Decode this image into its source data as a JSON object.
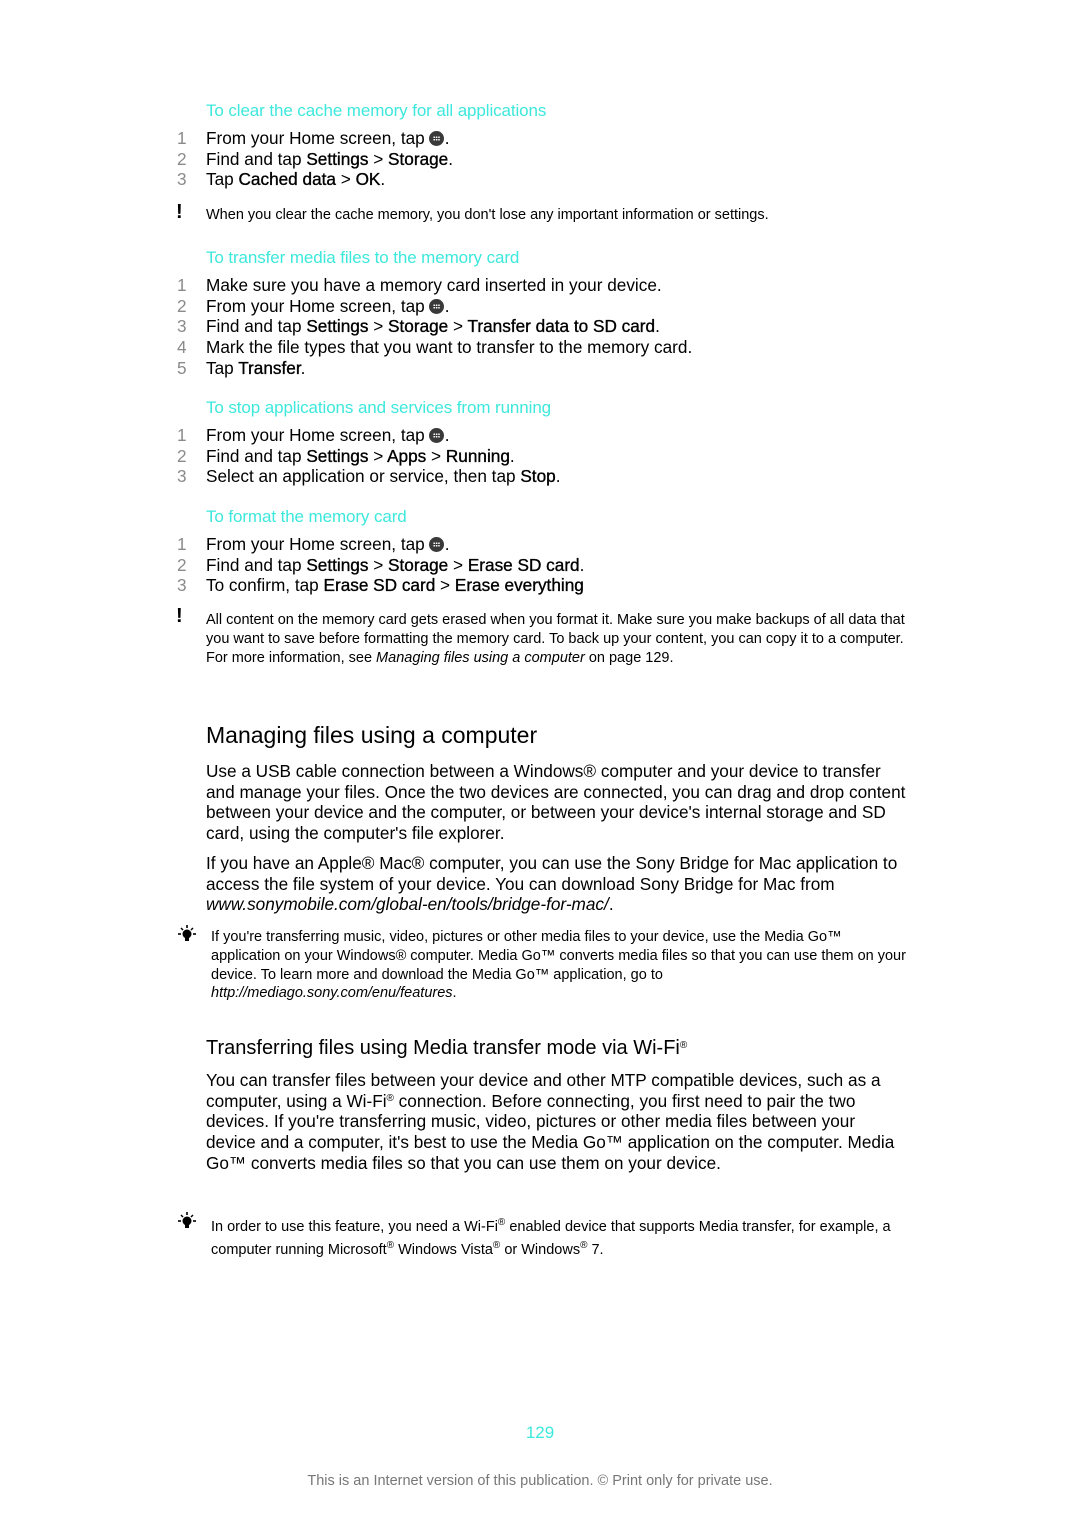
{
  "sections": [
    {
      "heading": "To clear the cache memory for all applications",
      "steps": [
        {
          "num": "1",
          "pre": "From your Home screen, tap",
          "icon": "apps-icon",
          "post": "."
        },
        {
          "num": "2",
          "pre": "Find and tap ",
          "b1": "Settings",
          "sep1": " > ",
          "b2": "Storage",
          "post": "."
        },
        {
          "num": "3",
          "pre": "Tap ",
          "b1": "Cached data",
          "sep1": " > ",
          "b2": "OK",
          "post": "."
        }
      ],
      "note": {
        "icon": "warning-icon",
        "text": "When you clear the cache memory, you don't lose any important information or settings."
      }
    },
    {
      "heading": "To transfer media files to the memory card",
      "steps": [
        {
          "num": "1",
          "text": "Make sure you have a memory card inserted in your device."
        },
        {
          "num": "2",
          "pre": "From your Home screen, tap",
          "icon": "apps-icon",
          "post": "."
        },
        {
          "num": "3",
          "pre": "Find and tap ",
          "b1": "Settings",
          "sep1": " > ",
          "b2": "Storage",
          "sep2": " > ",
          "b3": "Transfer data to SD card",
          "post": "."
        },
        {
          "num": "4",
          "text": "Mark the file types that you want to transfer to the memory card."
        },
        {
          "num": "5",
          "pre": "Tap ",
          "b1": "Transfer",
          "post": "."
        }
      ]
    },
    {
      "heading": "To stop applications and services from running",
      "steps": [
        {
          "num": "1",
          "pre": "From your Home screen, tap",
          "icon": "apps-icon",
          "post": "."
        },
        {
          "num": "2",
          "pre": "Find and tap ",
          "b1": "Settings",
          "sep1": " > ",
          "b2": "Apps",
          "sep2": " > ",
          "b3": "Running",
          "post": "."
        },
        {
          "num": "3",
          "pre": "Select an application or service, then tap ",
          "b1": "Stop",
          "post": "."
        }
      ]
    },
    {
      "heading": "To format the memory card",
      "steps": [
        {
          "num": "1",
          "pre": "From your Home screen, tap",
          "icon": "apps-icon",
          "post": "."
        },
        {
          "num": "2",
          "pre": "Find and tap ",
          "b1": "Settings",
          "sep1": " > ",
          "b2": "Storage",
          "sep2": " > ",
          "b3": "Erase SD card",
          "post": "."
        },
        {
          "num": "3",
          "pre": "To confirm, tap ",
          "b1": "Erase SD card",
          "sep1": " > ",
          "b2": "Erase everything",
          "post": ""
        }
      ],
      "note": {
        "icon": "warning-icon",
        "text_before": "All content on the memory card gets erased when you format it. Make sure you make backups of all data that you want to save before formatting the memory card. To back up your content, you can copy it to a computer. For more information, see ",
        "link": "Managing files using a computer",
        "text_after": " on page 129."
      }
    }
  ],
  "managing": {
    "title": "Managing files using a computer",
    "para1": "Use a USB cable connection between a Windows® computer and your device to transfer and manage your files. Once the two devices are connected, you can drag and drop content between your device and the computer, or between your device's internal storage and SD card, using the computer's file explorer.",
    "para2_before": "If you have an Apple® Mac® computer, you can use the Sony Bridge for Mac application to access the file system of your device. You can download Sony Bridge for Mac from ",
    "para2_link": "www.sonymobile.com/global-en/tools/bridge-for-mac/",
    "para2_after": ".",
    "tip": {
      "icon": "tip-lightbulb-icon",
      "text_before": "If you're transferring music, video, pictures or other media files to your device, use the Media Go™ application on your Windows® computer. Media Go™ converts media files so that you can use them on your device. To learn more and download the Media Go™ application, go to ",
      "link": "http://mediago.sony.com/enu/features",
      "text_after": "."
    }
  },
  "wifi": {
    "title": "Transferring files using Media transfer mode via Wi-Fi",
    "title_sup": "®",
    "para_a": "You can transfer files between your device and other MTP compatible devices, such as a computer, using a Wi-Fi",
    "para_sup": "®",
    "para_b": " connection. Before connecting, you first need to pair the two devices. If you're transferring music, video, pictures or other media files between your device and a computer, it's best to use the Media Go™ application on the computer. Media Go™ converts media files so that you can use them on your device.",
    "tip": {
      "icon": "tip-lightbulb-icon",
      "t1": "In order to use this feature, you need a Wi-Fi",
      "s1": "®",
      "t2": " enabled device that supports Media transfer, for example, a computer running Microsoft",
      "s2": "®",
      "t3": " Windows Vista",
      "s3": "®",
      "t4": " or Windows",
      "s4": "®",
      "t5": " 7."
    }
  },
  "page_number": "129",
  "footer": "This is an Internet version of this publication. © Print only for private use.",
  "colors": {
    "accent": "#3de8dc",
    "step_number": "#8a8a8a",
    "footer": "#777777"
  }
}
